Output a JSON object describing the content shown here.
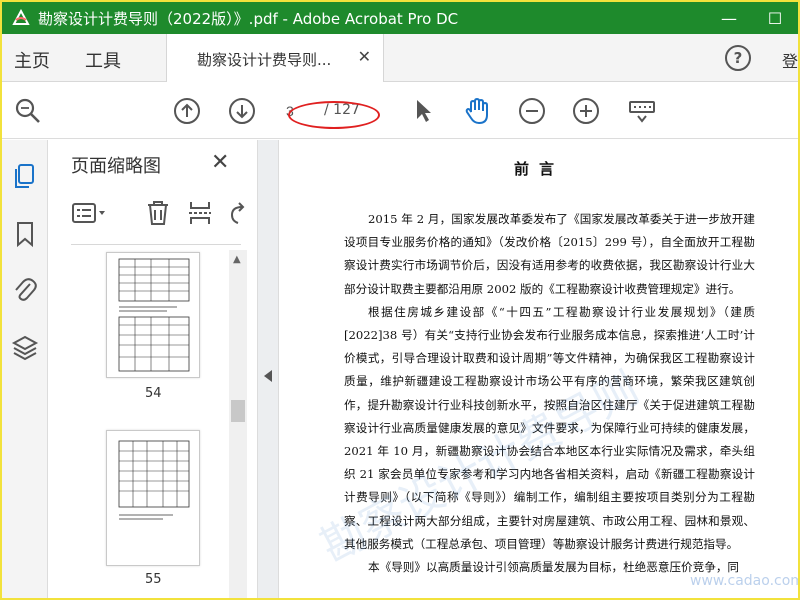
{
  "window": {
    "title": "勘察设计计费导则（2022版）》.pdf - Adobe Acrobat Pro DC",
    "controls": {
      "minimize": "—",
      "maximize": "☐"
    },
    "accent_color": "#1e8a2c"
  },
  "tabs": {
    "home": "主页",
    "tools": "工具",
    "document_tab": "勘察设计计费导则...",
    "sign_in_partial": "登"
  },
  "toolbar": {
    "page_current": "3",
    "page_total": "/ 127",
    "icons": [
      "search-zoom-icon",
      "prev-page-icon",
      "next-page-icon",
      "select-cursor-icon",
      "hand-tool-icon",
      "zoom-out-icon",
      "zoom-in-icon",
      "keyboard-icon"
    ]
  },
  "rail": {
    "icons": [
      "page-thumbnails-icon",
      "bookmark-icon",
      "attachment-icon",
      "layers-icon"
    ]
  },
  "thumbnails": {
    "title": "页面缩略图",
    "pages": [
      {
        "label": "54"
      },
      {
        "label": "55"
      }
    ]
  },
  "document": {
    "heading": "前言",
    "paragraphs": [
      "2015 年 2 月，国家发展改革委发布了《国家发展改革委关于进一步放开建设项目专业服务价格的通知》（发改价格〔2015〕299 号），自全面放开工程勘察设计费实行市场调节价后，因没有适用参考的收费依据，我区勘察设计行业大部分设计取费主要都沿用原 2002 版的《工程勘察设计收费管理规定》进行。",
      "根据住房城乡建设部《“十四五”工程勘察设计行业发展规划》（建质[2022]38 号）有关“支持行业协会发布行业服务成本信息，探索推进‘人工时’计价模式，引导合理设计取费和设计周期”等文件精神，为确保我区工程勘察设计质量，维护新疆建设工程勘察设计市场公平有序的营商环境，繁荣我区建筑创作，提升勘察设计行业科技创新水平，按照自治区住建厅《关于促进建筑工程勘察设计行业高质量健康发展的意见》文件要求，为保障行业可持续的健康发展，2021 年 10 月，新疆勘察设计协会结合本地区本行业实际情况及需求，牵头组织 21 家会员单位专家参考和学习内地各省相关资料，启动《新疆工程勘察设计计费导则》（以下简称《导则》）编制工作，编制组主要按项目类别分为工程勘察、工程设计两大部分组成，主要针对房屋建筑、市政公用工程、园林和景观、其他服务模式（工程总承包、项目管理）等勘察设计服务计费进行规范指导。",
      "本《导则》以高质量设计引领高质量发展为目标，杜绝恶意压价竞争，同"
    ]
  },
  "watermark": {
    "text": "勘察设计计费导则",
    "site": "www.cadao.com"
  }
}
